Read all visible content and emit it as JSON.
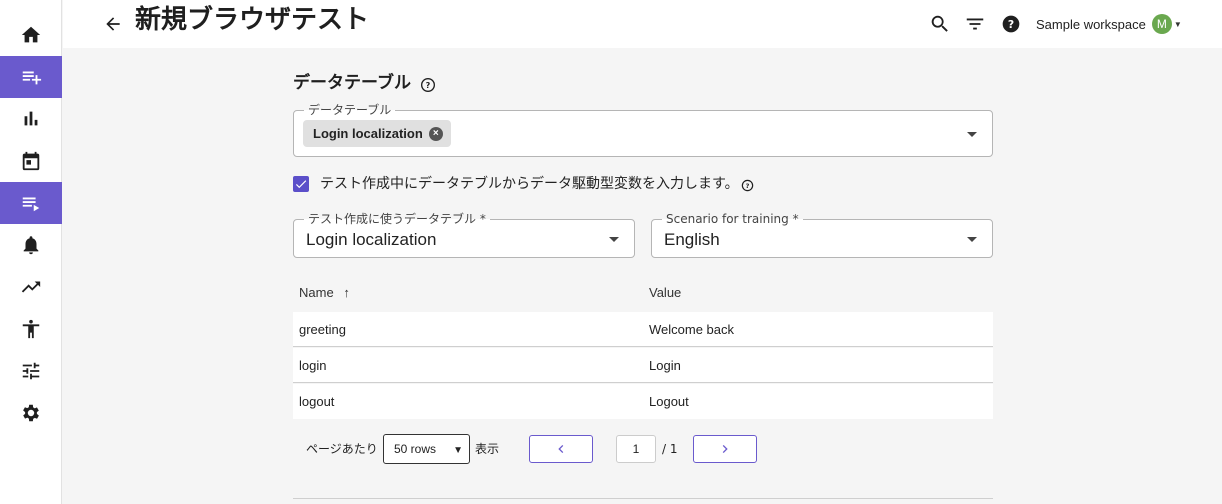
{
  "header": {
    "title": "新規ブラウザテスト",
    "workspace": "Sample workspace",
    "avatar_initial": "M"
  },
  "sidebar": {
    "items": [
      {
        "icon": "home-icon",
        "active": false
      },
      {
        "icon": "playlist-add-icon",
        "active": true
      },
      {
        "icon": "bar-chart-icon",
        "active": false
      },
      {
        "icon": "calendar-icon",
        "active": false
      },
      {
        "icon": "playlist-play-icon",
        "active": true
      },
      {
        "icon": "bell-icon",
        "active": false
      },
      {
        "icon": "trending-up-icon",
        "active": false
      },
      {
        "icon": "accessibility-icon",
        "active": false
      },
      {
        "icon": "tune-icon",
        "active": false
      },
      {
        "icon": "gear-icon",
        "active": false
      }
    ]
  },
  "section": {
    "title": "データテーブル"
  },
  "datatable_field": {
    "label": "データテーブル",
    "chip": "Login localization"
  },
  "checkbox": {
    "label": "テスト作成中にデータテブルからデータ駆動型変数を入力します。",
    "checked": true
  },
  "table_select": {
    "label": "テスト作成に使うデータテブル *",
    "value": "Login localization"
  },
  "scenario_select": {
    "label": "Scenario for training *",
    "value": "English"
  },
  "table": {
    "columns": [
      "Name",
      "Value"
    ],
    "sort_indicator": "↑",
    "rows": [
      {
        "name": "greeting",
        "value": "Welcome back"
      },
      {
        "name": "login",
        "value": "Login"
      },
      {
        "name": "logout",
        "value": "Logout"
      }
    ]
  },
  "pagination": {
    "per_page_label": "ページあたり",
    "rows_value": "50 rows",
    "display_label": "表示",
    "page": "1",
    "total": "/ 1"
  },
  "colors": {
    "accent": "#6a5acd",
    "avatar": "#6aa84f"
  }
}
